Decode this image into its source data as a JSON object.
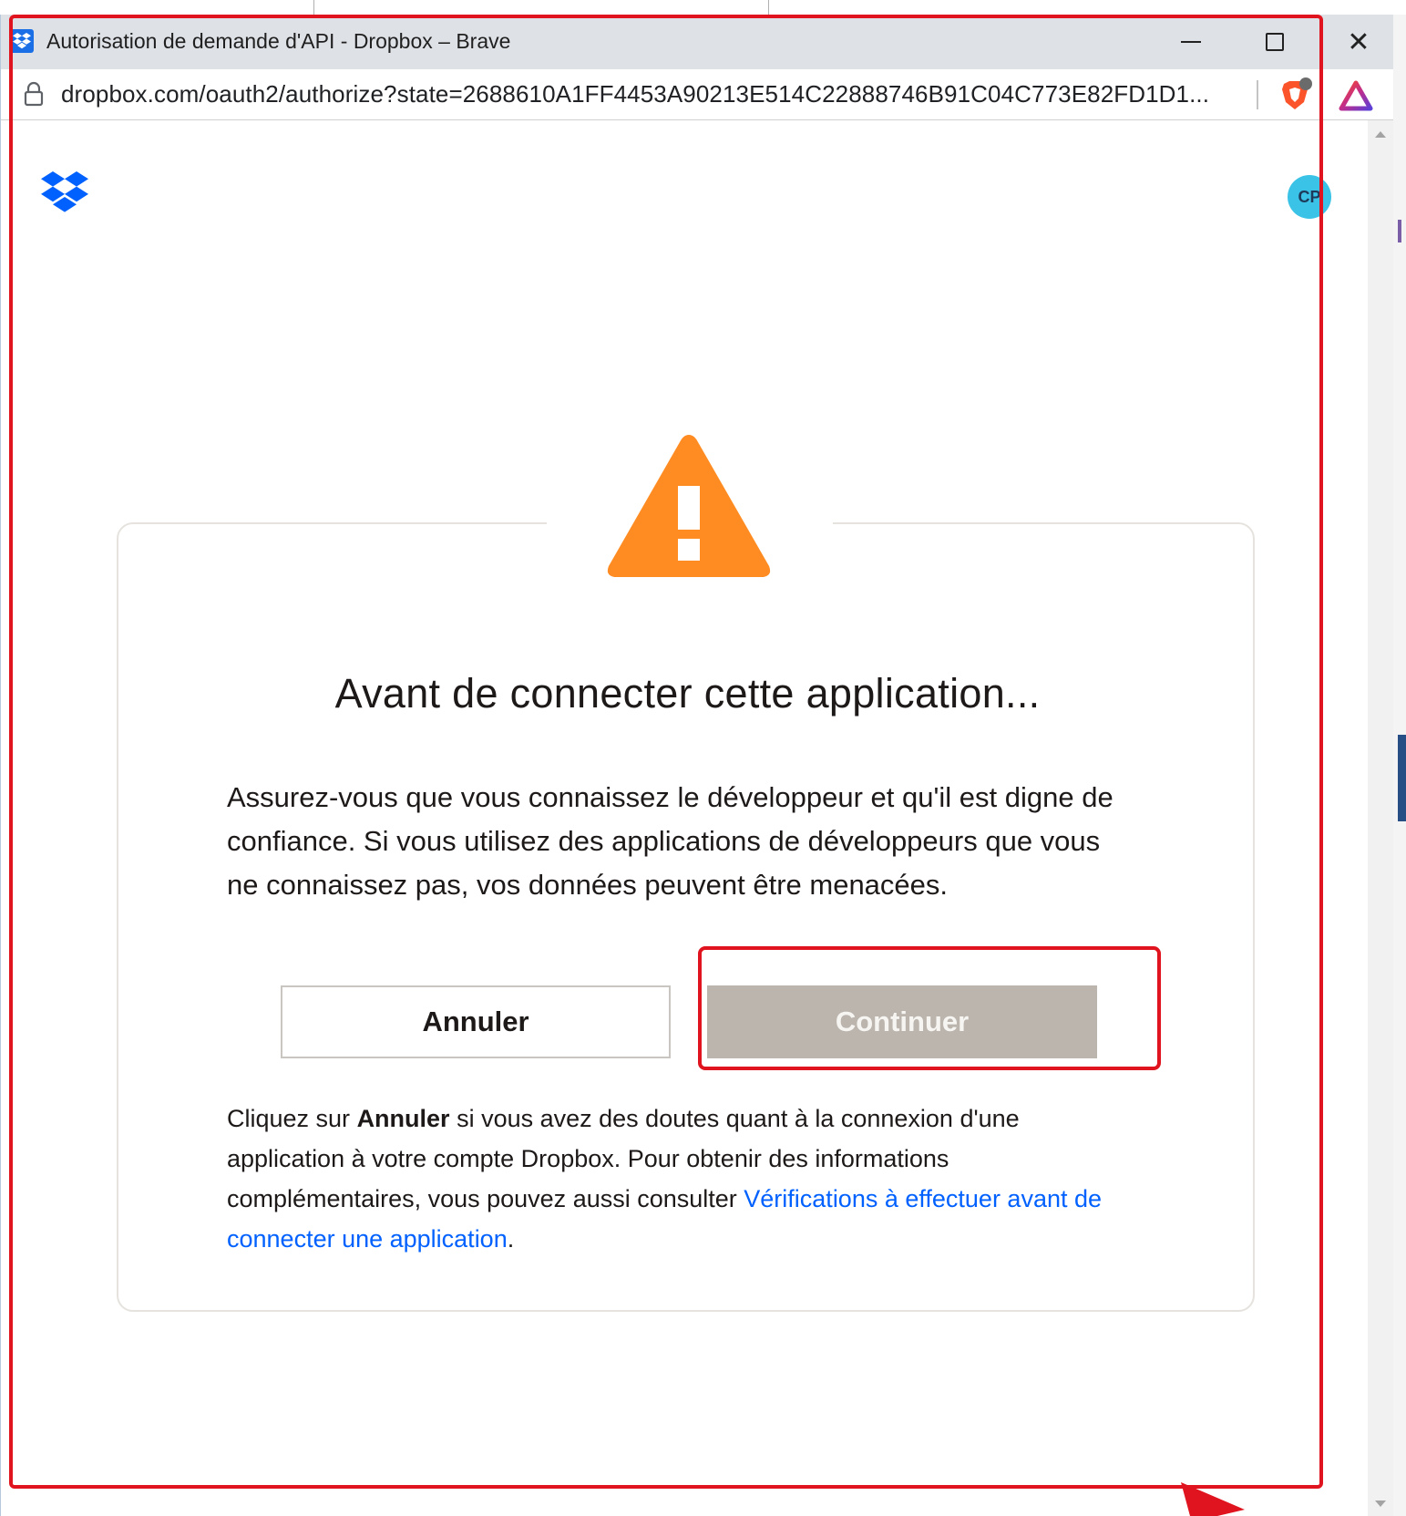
{
  "window": {
    "title": "Autorisation de demande d'API - Dropbox – Brave",
    "url": "dropbox.com/oauth2/authorize?state=2688610A1FF4453A90213E514C22888746B91C04C773E82FD1D1...",
    "close_glyph": "✕"
  },
  "header": {
    "avatar_initials": "CP"
  },
  "dialog": {
    "title": "Avant de connecter cette application...",
    "body": "Assurez-vous que vous connaissez le développeur et qu'il est digne de confiance. Si vous utilisez des applications de développeurs que vous ne connaissez pas, vos données peuvent être menacées.",
    "cancel_label": "Annuler",
    "continue_label": "Continuer",
    "note_prefix": "Cliquez sur ",
    "note_bold": "Annuler",
    "note_middle": " si vous avez des doutes quant à la connexion d'une application à votre compte Dropbox. Pour obtenir des informations complémentaires, vous pouvez aussi consulter ",
    "note_link": "Vérifications à effectuer avant de connecter une application",
    "note_suffix": "."
  },
  "colors": {
    "dropbox_blue": "#0061fe",
    "warning_orange": "#ff8c22",
    "continue_disabled": "#bbb5ae",
    "annotation_red": "#e0141e"
  },
  "icons": {
    "favicon": "dropbox-icon",
    "lock": "lock-icon",
    "brave": "brave-shield-icon",
    "rewards": "brave-rewards-icon",
    "logo": "dropbox-logo-icon",
    "warning": "warning-triangle-icon"
  }
}
